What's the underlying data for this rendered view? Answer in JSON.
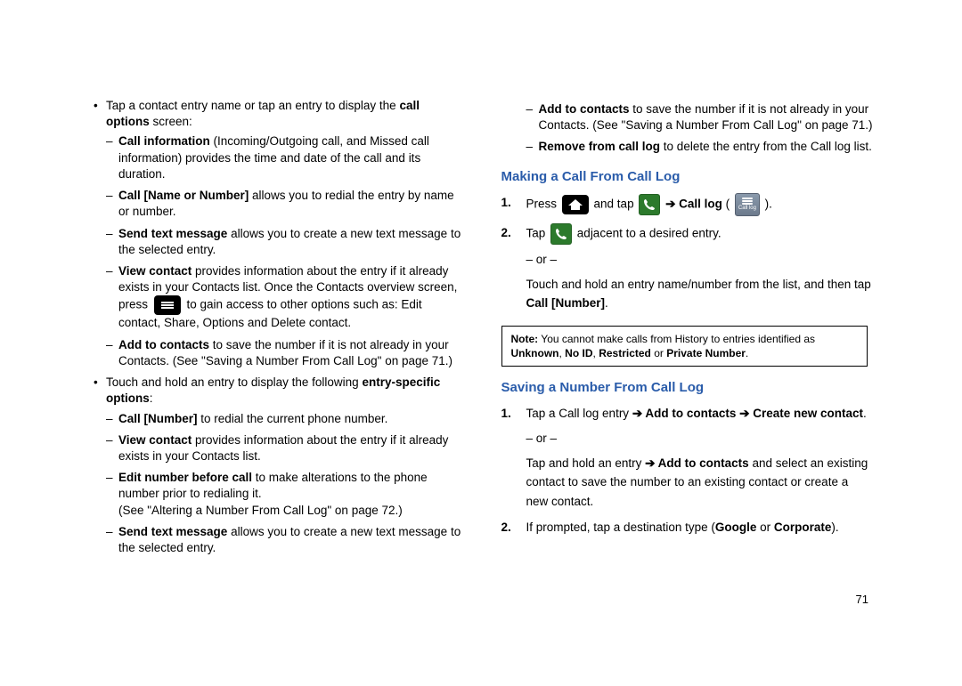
{
  "left": {
    "b1_pre": "Tap a contact entry name or tap an entry to display the ",
    "b1_bold": "call options",
    "b1_post": " screen:",
    "s1a_bold": "Call information",
    "s1a_rest": " (Incoming/Outgoing call, and Missed call information) provides the time and date of the call and its duration.",
    "s1b_bold": "Call [Name or Number]",
    "s1b_rest": " allows you to redial the entry by name or number.",
    "s1c_bold": "Send text message",
    "s1c_rest": " allows you to create a new text message to the selected entry.",
    "s1d_bold": "View contact",
    "s1d_rest": " provides information about the entry if it already exists in your Contacts list. Once the Contacts overview screen, press",
    "s1d_after_icon": " to gain access to other options such as: Edit contact, Share, Options and Delete contact.",
    "s1e_bold": "Add to contacts",
    "s1e_rest": " to save the number if it is not already in your Contacts. (See \"Saving a Number From Call Log\" on page 71.)",
    "b2_pre": "Touch and hold an entry to display the following ",
    "b2_bold": "entry-specific options",
    "b2_post": ":",
    "s2a_bold": "Call [Number]",
    "s2a_rest": " to redial the current phone number.",
    "s2b_bold": "View contact",
    "s2b_rest": " provides information about the entry if it already exists in your Contacts list.",
    "s2c_bold": "Edit number before call",
    "s2c_rest": " to make alterations to the phone number prior to redialing it.",
    "s2c_ref": "(See \"Altering a Number From Call Log\" on page 72.)",
    "s2d_bold": "Send text message",
    "s2d_rest": " allows you to create a new text message to the selected entry."
  },
  "right": {
    "rs1_bold": "Add to contacts",
    "rs1_rest": " to save the number if it is not already in your Contacts. (See \"Saving a Number From Call Log\" on page 71.)",
    "rs2_bold": "Remove from call log",
    "rs2_rest": " to delete the entry from the Call log list.",
    "heading1": "Making a Call From Call Log",
    "step1_press": "Press ",
    "step1_andtap": " and tap ",
    "step1_arrow": " ➔ ",
    "step1_calllog": "Call log",
    "step1_paren_open": " ( ",
    "step1_paren_close": " ).",
    "step2_tap": "Tap ",
    "step2_rest": " adjacent to a desired entry.",
    "or": "– or –",
    "hold_line": "Touch and hold an entry name/number from the list, and then tap ",
    "hold_bold": "Call [Number]",
    "hold_end": ".",
    "note": {
      "label": "Note:",
      "pre": " You cannot make calls from History to entries identified as ",
      "unknown": "Unknown",
      "sep1": ", ",
      "noid": "No ID",
      "sep2": ", ",
      "restricted": "Restricted",
      "or": " or ",
      "private": "Private Number",
      "end": "."
    },
    "heading2": "Saving a Number From Call Log",
    "sv1_pre": "Tap a Call log entry ",
    "sv1_arrow": "➔",
    "sv1_add": " Add to contacts ",
    "sv1_create": " Create new contact",
    "sv1_end": ".",
    "sv_or_hold_pre": "Tap and hold an entry ",
    "sv_or_hold_arrow": "➔",
    "sv_or_hold_bold": " Add to contacts",
    "sv_or_hold_rest": " and select an existing contact to save the number to an existing contact or create a new contact.",
    "sv2_pre": "If prompted, tap a destination type (",
    "sv2_google": "Google",
    "sv2_or": " or ",
    "sv2_corp": "Corporate",
    "sv2_end": ").",
    "calllog_label": "Call log"
  },
  "page_number": "71"
}
